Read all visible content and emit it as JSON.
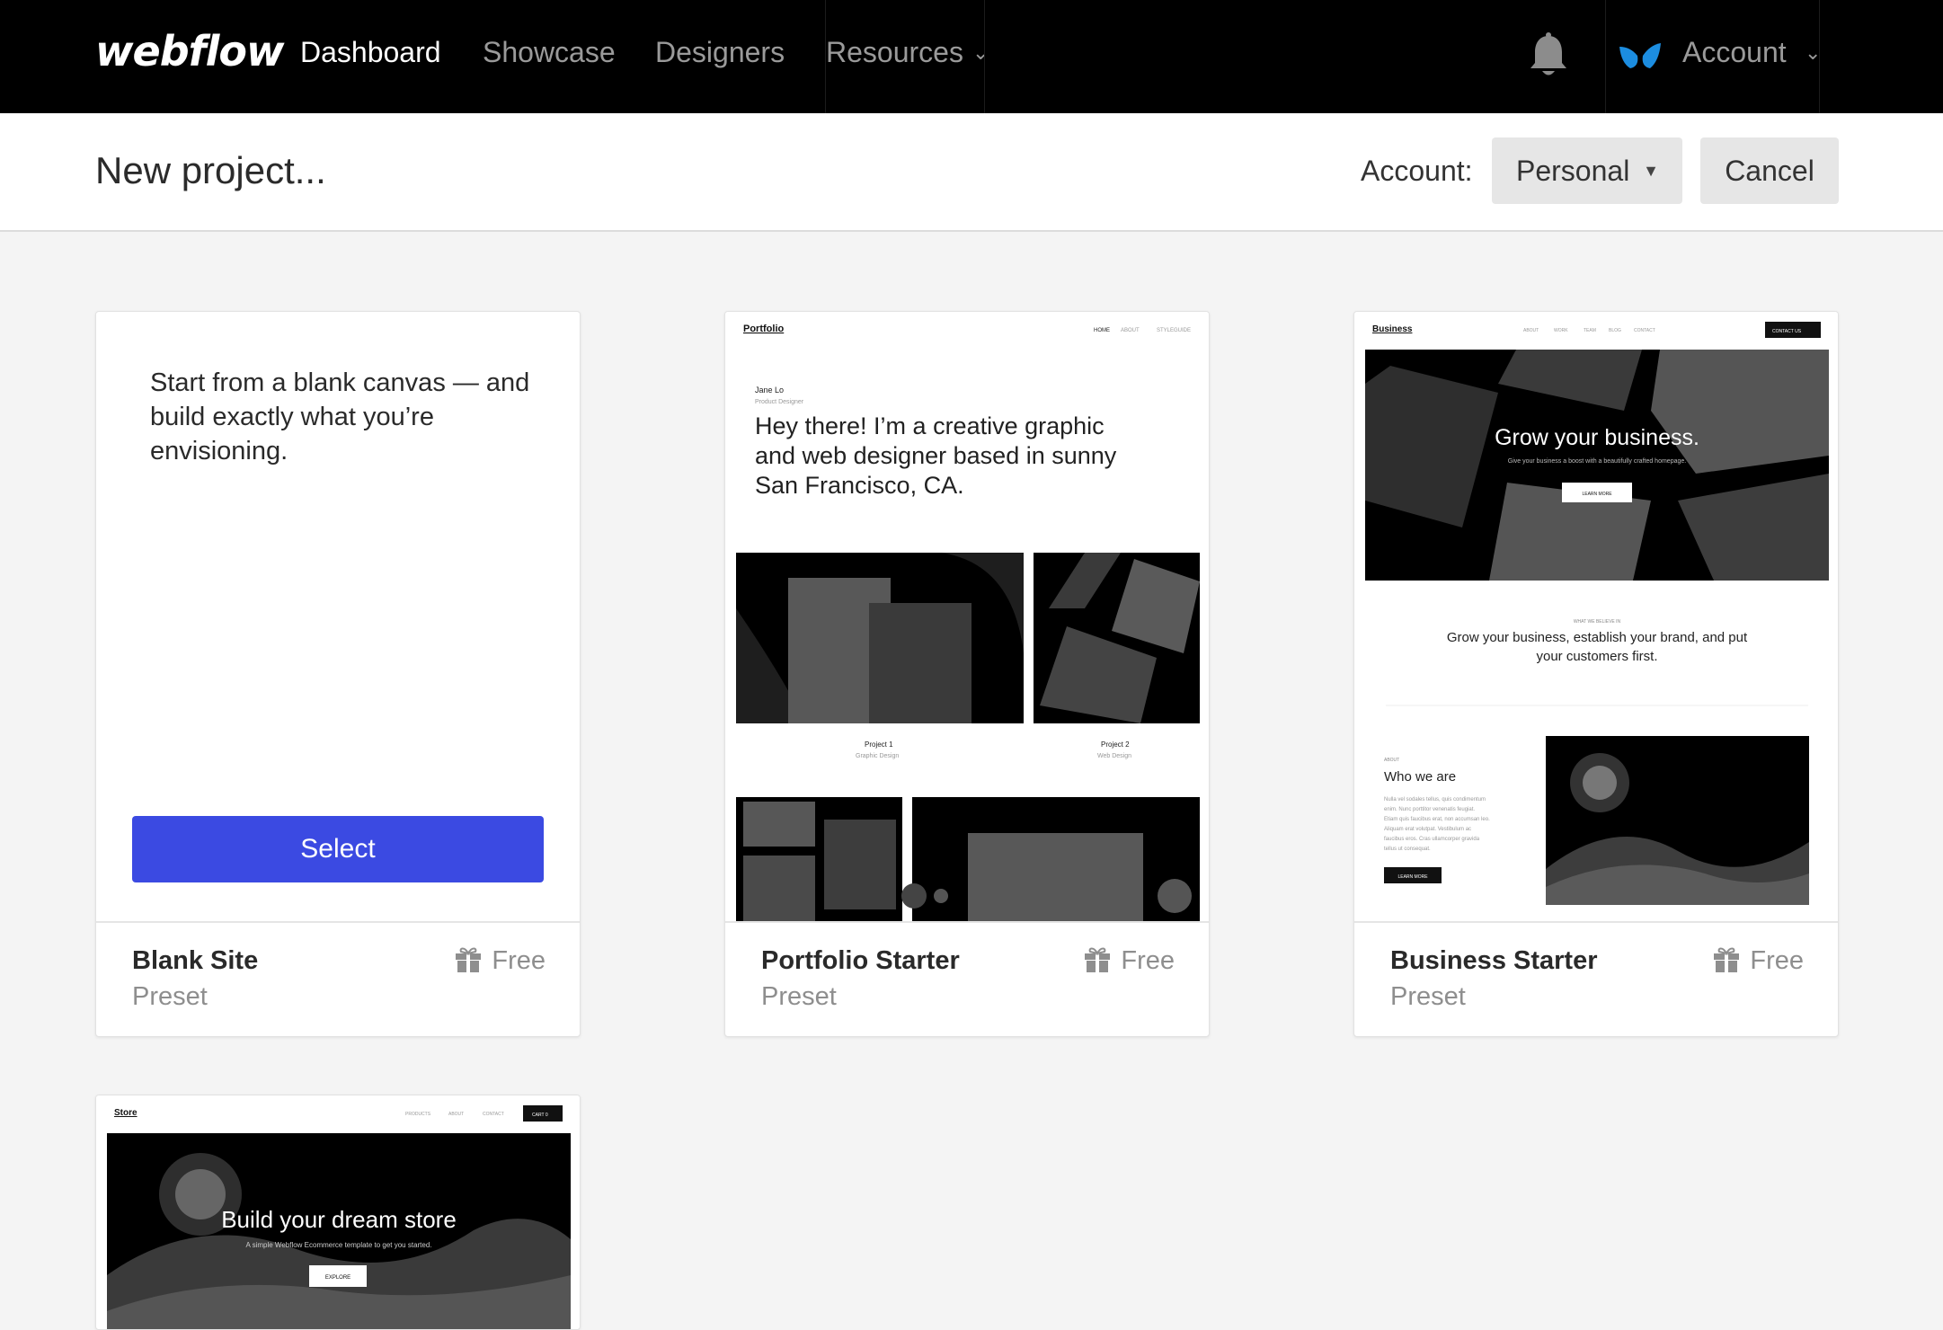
{
  "nav": {
    "logo": "webflow",
    "links": [
      {
        "label": "Dashboard",
        "active": true
      },
      {
        "label": "Showcase",
        "active": false
      },
      {
        "label": "Designers",
        "active": false
      },
      {
        "label": "Resources",
        "active": false
      }
    ],
    "account_label": "Account",
    "icons": {
      "notifications": "bell-icon",
      "brand": "webflow-mark-icon",
      "dropdown": "chevron-down-icon"
    },
    "brand_color": "#1c8de0"
  },
  "subheader": {
    "title": "New project...",
    "account_field_label": "Account:",
    "account_value": "Personal",
    "cancel_label": "Cancel"
  },
  "cards": [
    {
      "name": "Blank Site",
      "kind": "Preset",
      "price": "Free",
      "description": "Start from a blank canvas — and build exactly what you’re envisioning.",
      "select_label": "Select",
      "select_color": "#3b4ae2"
    },
    {
      "name": "Portfolio Starter",
      "kind": "Preset",
      "price": "Free",
      "preview": {
        "brand": "Portfolio",
        "nav": [
          "HOME",
          "ABOUT",
          "STYLEGUIDE"
        ],
        "person": "Jane Lo",
        "role": "Product Designer",
        "headline": [
          "Hey there! I’m a creative graphic",
          "and web designer based in sunny",
          "San Francisco, CA."
        ],
        "projects": [
          {
            "title": "Project 1",
            "sub": "Graphic Design"
          },
          {
            "title": "Project 2",
            "sub": "Web Design"
          }
        ]
      }
    },
    {
      "name": "Business Starter",
      "kind": "Preset",
      "price": "Free",
      "preview": {
        "brand": "Business",
        "nav": [
          "ABOUT",
          "WORK",
          "TEAM",
          "BLOG",
          "CONTACT"
        ],
        "cta": "CONTACT US",
        "hero_title": "Grow your business.",
        "hero_sub": "Give your business a boost with a beautifully crafted homepage.",
        "hero_button": "LEARN MORE",
        "eyebrow": "WHAT WE BELIEVE IN",
        "statement": [
          "Grow your business, establish your brand, and put",
          "your customers first."
        ],
        "about_eyebrow": "ABOUT",
        "about_title": "Who we are",
        "about_body": [
          "Nulla vel sodales tellus, quis condimentum",
          "enim. Nunc porttitor venenatis feugiat.",
          "Etiam quis faucibus erat, non accumsan leo.",
          "Aliquam erat volutpat. Vestibulum ac",
          "faucibus eros. Cras ullamcorper gravida",
          "tellus ut consequat."
        ],
        "about_button": "LEARN MORE"
      }
    },
    {
      "preview": {
        "brand": "Store",
        "nav": [
          "PRODUCTS",
          "ABOUT",
          "CONTACT"
        ],
        "cart": "CART  0",
        "hero_title": "Build your dream store",
        "hero_sub": "A simple Webflow Ecommerce template to get you started.",
        "hero_button": "EXPLORE"
      }
    }
  ]
}
